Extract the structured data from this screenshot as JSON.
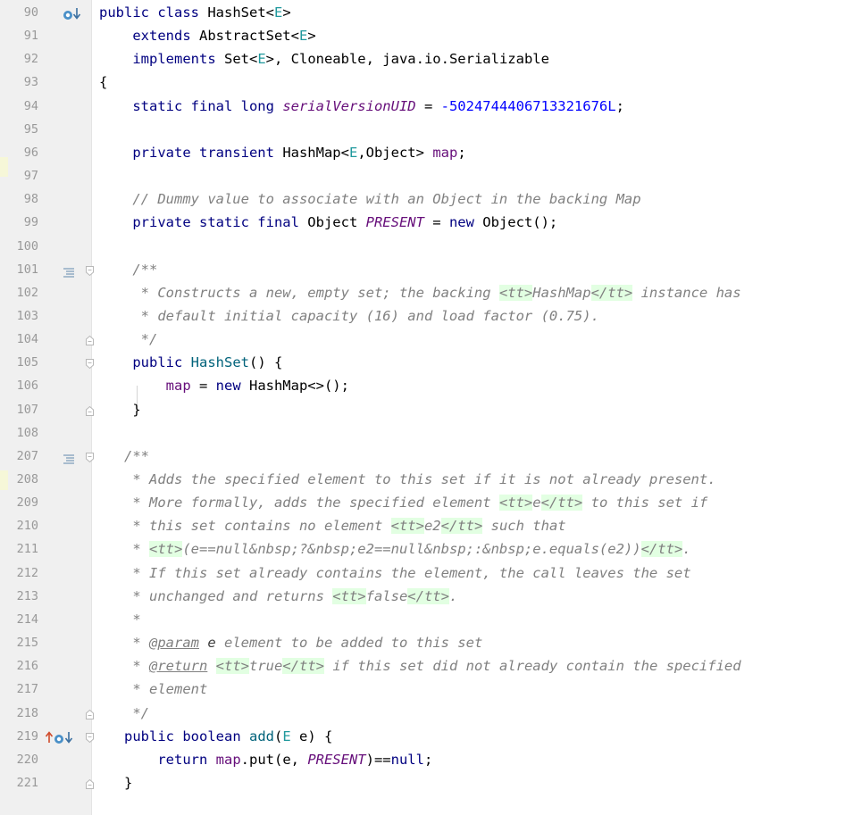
{
  "editor": {
    "file": "HashSet.java",
    "lines": [
      {
        "n": "90",
        "icons": [
          "overrides-icon",
          "down-arrow-icon"
        ],
        "tokens": [
          [
            "kw",
            "public class "
          ],
          [
            "",
            "HashSet<"
          ],
          [
            "tp",
            "E"
          ],
          [
            "",
            ">"
          ]
        ]
      },
      {
        "n": "91",
        "icons": [],
        "tokens": [
          [
            "",
            "    "
          ],
          [
            "kw",
            "extends "
          ],
          [
            "",
            "AbstractSet<"
          ],
          [
            "tp",
            "E"
          ],
          [
            "",
            ">"
          ]
        ]
      },
      {
        "n": "92",
        "icons": [],
        "tokens": [
          [
            "",
            "    "
          ],
          [
            "kw",
            "implements "
          ],
          [
            "",
            "Set<"
          ],
          [
            "tp",
            "E"
          ],
          [
            "",
            ">, Cloneable, java.io.Serializable"
          ]
        ]
      },
      {
        "n": "93",
        "icons": [],
        "tokens": [
          [
            "",
            "{"
          ]
        ]
      },
      {
        "n": "94",
        "icons": [],
        "tokens": [
          [
            "",
            "    "
          ],
          [
            "kw",
            "static final long "
          ],
          [
            "sfld",
            "serialVersionUID"
          ],
          [
            "",
            " = "
          ],
          [
            "num",
            "-5024744406713321676L"
          ],
          [
            "",
            ";"
          ]
        ]
      },
      {
        "n": "95",
        "icons": [],
        "tokens": []
      },
      {
        "n": "96",
        "icons": [],
        "tokens": [
          [
            "",
            "    "
          ],
          [
            "kw",
            "private transient "
          ],
          [
            "",
            "HashMap<"
          ],
          [
            "tp",
            "E"
          ],
          [
            "",
            ",Object> "
          ],
          [
            "fld",
            "map"
          ],
          [
            "",
            ";"
          ]
        ]
      },
      {
        "n": "97",
        "icons": [],
        "tokens": []
      },
      {
        "n": "98",
        "icons": [],
        "tokens": [
          [
            "",
            "    "
          ],
          [
            "cmt",
            "// Dummy value to associate with an Object in the backing Map"
          ]
        ]
      },
      {
        "n": "99",
        "icons": [],
        "tokens": [
          [
            "",
            "    "
          ],
          [
            "kw",
            "private static final "
          ],
          [
            "",
            "Object "
          ],
          [
            "sfld",
            "PRESENT"
          ],
          [
            "",
            " = "
          ],
          [
            "kw",
            "new "
          ],
          [
            "",
            "Object();"
          ]
        ]
      },
      {
        "n": "100",
        "icons": [],
        "tokens": []
      },
      {
        "n": "101",
        "icons": [
          "doc-lines-icon",
          "fold-icon"
        ],
        "tokens": [
          [
            "",
            "    "
          ],
          [
            "doc",
            "/**"
          ]
        ]
      },
      {
        "n": "102",
        "icons": [],
        "tokens": [
          [
            "",
            "    "
          ],
          [
            "doc",
            " * Constructs a new, empty set; the backing "
          ],
          [
            "tag",
            "<tt>"
          ],
          [
            "doc",
            "HashMap"
          ],
          [
            "tag",
            "</tt>"
          ],
          [
            "doc",
            " instance has"
          ]
        ]
      },
      {
        "n": "103",
        "icons": [],
        "tokens": [
          [
            "",
            "    "
          ],
          [
            "doc",
            " * default initial capacity (16) and load factor (0.75)."
          ]
        ]
      },
      {
        "n": "104",
        "icons": [
          "fold-end-icon"
        ],
        "tokens": [
          [
            "",
            "    "
          ],
          [
            "doc",
            " */"
          ]
        ]
      },
      {
        "n": "105",
        "icons": [
          "fold-icon"
        ],
        "tokens": [
          [
            "",
            "    "
          ],
          [
            "kw",
            "public "
          ],
          [
            "mdecl",
            "HashSet"
          ],
          [
            "",
            "() {"
          ]
        ]
      },
      {
        "n": "106",
        "icons": [],
        "tokens": [
          [
            "",
            "        "
          ],
          [
            "fld",
            "map"
          ],
          [
            "",
            " = "
          ],
          [
            "kw",
            "new "
          ],
          [
            "",
            "HashMap<>();"
          ]
        ]
      },
      {
        "n": "107",
        "icons": [
          "fold-end-icon"
        ],
        "tokens": [
          [
            "",
            "    }"
          ]
        ]
      },
      {
        "n": "108",
        "icons": [],
        "tokens": []
      },
      {
        "n": "207",
        "icons": [
          "doc-lines-icon",
          "fold-icon"
        ],
        "tokens": [
          [
            "",
            "   "
          ],
          [
            "doc",
            "/**"
          ]
        ]
      },
      {
        "n": "208",
        "icons": [],
        "tokens": [
          [
            "",
            "   "
          ],
          [
            "doc",
            " * Adds the specified element to this set if it is not already present."
          ]
        ]
      },
      {
        "n": "209",
        "icons": [],
        "tokens": [
          [
            "",
            "   "
          ],
          [
            "doc",
            " * More formally, adds the specified element "
          ],
          [
            "tag",
            "<tt>"
          ],
          [
            "doc",
            "e"
          ],
          [
            "tag",
            "</tt>"
          ],
          [
            "doc",
            " to this set if"
          ]
        ]
      },
      {
        "n": "210",
        "icons": [],
        "tokens": [
          [
            "",
            "   "
          ],
          [
            "doc",
            " * this set contains no element "
          ],
          [
            "tag",
            "<tt>"
          ],
          [
            "doc",
            "e2"
          ],
          [
            "tag",
            "</tt>"
          ],
          [
            "doc",
            " such that"
          ]
        ]
      },
      {
        "n": "211",
        "icons": [],
        "tokens": [
          [
            "",
            "   "
          ],
          [
            "doc",
            " * "
          ],
          [
            "tag",
            "<tt>"
          ],
          [
            "doc",
            "(e==null&nbsp;?&nbsp;e2==null&nbsp;:&nbsp;e.equals(e2))"
          ],
          [
            "tag",
            "</tt>"
          ],
          [
            "doc",
            "."
          ]
        ]
      },
      {
        "n": "212",
        "icons": [],
        "tokens": [
          [
            "",
            "   "
          ],
          [
            "doc",
            " * If this set already contains the element, the call leaves the set"
          ]
        ]
      },
      {
        "n": "213",
        "icons": [],
        "tokens": [
          [
            "",
            "   "
          ],
          [
            "doc",
            " * unchanged and returns "
          ],
          [
            "tag",
            "<tt>"
          ],
          [
            "doc",
            "false"
          ],
          [
            "tag",
            "</tt>"
          ],
          [
            "doc",
            "."
          ]
        ]
      },
      {
        "n": "214",
        "icons": [],
        "tokens": [
          [
            "",
            "   "
          ],
          [
            "doc",
            " *"
          ]
        ]
      },
      {
        "n": "215",
        "icons": [],
        "tokens": [
          [
            "",
            "   "
          ],
          [
            "doc",
            " * "
          ],
          [
            "jdtag",
            "@param"
          ],
          [
            "doc",
            " "
          ],
          [
            "pname",
            "e"
          ],
          [
            "doc",
            " element to be added to this set"
          ]
        ]
      },
      {
        "n": "216",
        "icons": [],
        "tokens": [
          [
            "",
            "   "
          ],
          [
            "doc",
            " * "
          ],
          [
            "jdtag",
            "@return"
          ],
          [
            "doc",
            " "
          ],
          [
            "tag",
            "<tt>"
          ],
          [
            "doc",
            "true"
          ],
          [
            "tag",
            "</tt>"
          ],
          [
            "doc",
            " if this set did not already contain the specified"
          ]
        ]
      },
      {
        "n": "217",
        "icons": [],
        "tokens": [
          [
            "",
            "   "
          ],
          [
            "doc",
            " * element"
          ]
        ]
      },
      {
        "n": "218",
        "icons": [
          "fold-end-icon"
        ],
        "tokens": [
          [
            "",
            "   "
          ],
          [
            "doc",
            " */"
          ]
        ]
      },
      {
        "n": "219",
        "icons": [
          "implements-up-icon",
          "overrides-icon",
          "down-arrow-icon",
          "fold-icon"
        ],
        "tokens": [
          [
            "",
            "   "
          ],
          [
            "kw",
            "public boolean "
          ],
          [
            "mdecl",
            "add"
          ],
          [
            "",
            "("
          ],
          [
            "tp",
            "E"
          ],
          [
            "",
            " e) {"
          ]
        ]
      },
      {
        "n": "220",
        "icons": [],
        "tokens": [
          [
            "",
            "       "
          ],
          [
            "kw",
            "return "
          ],
          [
            "fld",
            "map"
          ],
          [
            "",
            ".put(e, "
          ],
          [
            "sfld",
            "PRESENT"
          ],
          [
            "",
            ")=="
          ],
          [
            "kw",
            "null"
          ],
          [
            "",
            ";"
          ]
        ]
      },
      {
        "n": "221",
        "icons": [
          "fold-end-icon"
        ],
        "tokens": [
          [
            "",
            "   }"
          ]
        ]
      }
    ]
  },
  "colors": {
    "gutter": "#f0f0f0",
    "keyword": "#000080",
    "type_param": "#20999d",
    "field": "#660e7a",
    "number": "#0000ff",
    "comment": "#808080",
    "html_tag_bg": "#e2ffe2"
  }
}
